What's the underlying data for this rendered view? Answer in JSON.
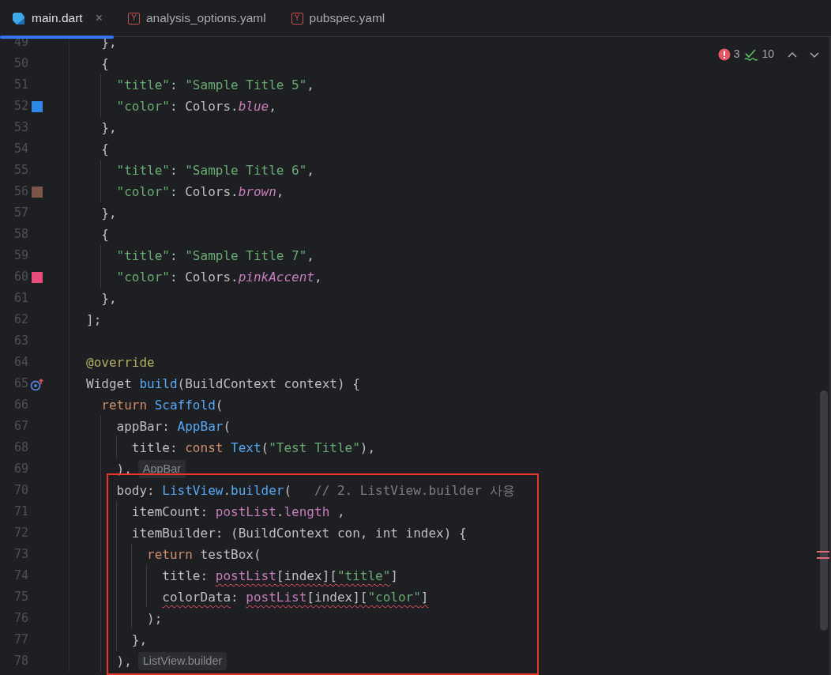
{
  "tabs": [
    {
      "label": "main.dart",
      "kind": "dart",
      "selected": true,
      "close_glyph": "×"
    },
    {
      "label": "analysis_options.yaml",
      "kind": "yaml",
      "selected": false,
      "icon_letter": "Y"
    },
    {
      "label": "pubspec.yaml",
      "kind": "yaml",
      "selected": false,
      "icon_letter": "Y"
    }
  ],
  "inspections": [
    {
      "kind": "error",
      "count": "3"
    },
    {
      "kind": "weak_warning",
      "count": "10"
    }
  ],
  "lines": [
    {
      "number": "49",
      "tokens": [
        {
          "kind": "plain",
          "text": "  },"
        }
      ]
    },
    {
      "number": "50",
      "tokens": [
        {
          "kind": "plain",
          "text": "  {"
        }
      ]
    },
    {
      "number": "51",
      "tokens": [
        {
          "kind": "string",
          "text": "    \"title\""
        },
        {
          "kind": "plain",
          "text": ": "
        },
        {
          "kind": "string",
          "text": "\"Sample Title 5\""
        },
        {
          "kind": "plain",
          "text": ","
        }
      ]
    },
    {
      "number": "52",
      "marker": {
        "kind": "color",
        "color": "#2f87e6"
      },
      "tokens": [
        {
          "kind": "string",
          "text": "    \"color\""
        },
        {
          "kind": "plain",
          "text": ": Colors."
        },
        {
          "kind": "field",
          "text": "blue"
        },
        {
          "kind": "plain",
          "text": ","
        }
      ]
    },
    {
      "number": "53",
      "tokens": [
        {
          "kind": "plain",
          "text": "  },"
        }
      ]
    },
    {
      "number": "54",
      "tokens": [
        {
          "kind": "plain",
          "text": "  {"
        }
      ]
    },
    {
      "number": "55",
      "tokens": [
        {
          "kind": "string",
          "text": "    \"title\""
        },
        {
          "kind": "plain",
          "text": ": "
        },
        {
          "kind": "string",
          "text": "\"Sample Title 6\""
        },
        {
          "kind": "plain",
          "text": ","
        }
      ]
    },
    {
      "number": "56",
      "marker": {
        "kind": "color",
        "color": "#7a5548"
      },
      "tokens": [
        {
          "kind": "string",
          "text": "    \"color\""
        },
        {
          "kind": "plain",
          "text": ": Colors."
        },
        {
          "kind": "field",
          "text": "brown"
        },
        {
          "kind": "plain",
          "text": ","
        }
      ]
    },
    {
      "number": "57",
      "tokens": [
        {
          "kind": "plain",
          "text": "  },"
        }
      ]
    },
    {
      "number": "58",
      "tokens": [
        {
          "kind": "plain",
          "text": "  {"
        }
      ]
    },
    {
      "number": "59",
      "tokens": [
        {
          "kind": "string",
          "text": "    \"title\""
        },
        {
          "kind": "plain",
          "text": ": "
        },
        {
          "kind": "string",
          "text": "\"Sample Title 7\""
        },
        {
          "kind": "plain",
          "text": ","
        }
      ]
    },
    {
      "number": "60",
      "marker": {
        "kind": "color",
        "color": "#ea4b7d"
      },
      "tokens": [
        {
          "kind": "string",
          "text": "    \"color\""
        },
        {
          "kind": "plain",
          "text": ": Colors."
        },
        {
          "kind": "field",
          "text": "pinkAccent"
        },
        {
          "kind": "plain",
          "text": ","
        }
      ]
    },
    {
      "number": "61",
      "tokens": [
        {
          "kind": "plain",
          "text": "  },"
        }
      ]
    },
    {
      "number": "62",
      "tokens": [
        {
          "kind": "plain",
          "text": "];"
        }
      ]
    },
    {
      "number": "63"
    },
    {
      "number": "64",
      "tokens": [
        {
          "kind": "annotation",
          "text": "@override"
        }
      ]
    },
    {
      "number": "65",
      "marker": {
        "kind": "override"
      },
      "tokens": [
        {
          "kind": "plain",
          "text": "Widget "
        },
        {
          "kind": "function",
          "text": "build"
        },
        {
          "kind": "plain",
          "text": "(BuildContext context) {"
        }
      ]
    },
    {
      "number": "66",
      "tokens": [
        {
          "kind": "keyword",
          "text": "  return "
        },
        {
          "kind": "type",
          "text": "Scaffold"
        },
        {
          "kind": "plain",
          "text": "("
        }
      ]
    },
    {
      "number": "67",
      "tokens": [
        {
          "kind": "plain",
          "text": "    appBar: "
        },
        {
          "kind": "type",
          "text": "AppBar"
        },
        {
          "kind": "plain",
          "text": "("
        }
      ]
    },
    {
      "number": "68",
      "tokens": [
        {
          "kind": "plain",
          "text": "      title: "
        },
        {
          "kind": "keyword",
          "text": "const "
        },
        {
          "kind": "type",
          "text": "Text"
        },
        {
          "kind": "plain",
          "text": "("
        },
        {
          "kind": "string",
          "text": "\"Test Title\""
        },
        {
          "kind": "plain",
          "text": "),"
        }
      ]
    },
    {
      "number": "69",
      "tokens": [
        {
          "kind": "plain",
          "text": "    ),"
        },
        {
          "kind": "hint",
          "text": "AppBar"
        }
      ]
    }
  ],
  "annotation_box": {
    "lines": [
      {
        "number": "70",
        "tokens": [
          {
            "kind": "plain",
            "text": "    body: "
          },
          {
            "kind": "type",
            "text": "ListView"
          },
          {
            "kind": "plain",
            "text": "."
          },
          {
            "kind": "function",
            "text": "builder"
          },
          {
            "kind": "plain",
            "text": "(   "
          },
          {
            "kind": "comment",
            "text": "// 2. ListView.builder 사용"
          }
        ]
      },
      {
        "number": "71",
        "tokens": [
          {
            "kind": "plain",
            "text": "      itemCount: "
          },
          {
            "kind": "variable",
            "text": "postList"
          },
          {
            "kind": "plain",
            "text": "."
          },
          {
            "kind": "variable",
            "text": "length"
          },
          {
            "kind": "plain",
            "text": " ,"
          }
        ]
      },
      {
        "number": "72",
        "tokens": [
          {
            "kind": "plain",
            "text": "      itemBuilder: (BuildContext con, int index) {"
          }
        ]
      },
      {
        "number": "73",
        "tokens": [
          {
            "kind": "keyword",
            "text": "        return "
          },
          {
            "kind": "plain",
            "text": "testBox("
          }
        ]
      },
      {
        "number": "74",
        "tokens": [
          {
            "kind": "plain",
            "text": "          title: "
          },
          {
            "kind": "variable",
            "text": "postList",
            "squiggle": true
          },
          {
            "kind": "plain",
            "text": "[index][",
            "squiggle": true
          },
          {
            "kind": "string",
            "text": "\"title\"",
            "squiggle": true
          },
          {
            "kind": "plain",
            "text": "]"
          }
        ]
      },
      {
        "number": "75",
        "tokens": [
          {
            "kind": "plain",
            "text": "          colorData",
            "squiggle": true
          },
          {
            "kind": "plain",
            "text": ": "
          },
          {
            "kind": "variable",
            "text": "postList",
            "squiggle": true
          },
          {
            "kind": "plain",
            "text": "[index][",
            "squiggle": true
          },
          {
            "kind": "string",
            "text": "\"color\"",
            "squiggle": true
          },
          {
            "kind": "plain",
            "text": "]",
            "squiggle": true
          }
        ]
      },
      {
        "number": "76",
        "tokens": [
          {
            "kind": "plain",
            "text": "        );"
          }
        ]
      },
      {
        "number": "77",
        "tokens": [
          {
            "kind": "plain",
            "text": "      },"
          }
        ]
      },
      {
        "number": "78",
        "tokens": [
          {
            "kind": "plain",
            "text": "    ),"
          },
          {
            "kind": "hint",
            "text": "ListView.builder"
          }
        ]
      }
    ]
  }
}
